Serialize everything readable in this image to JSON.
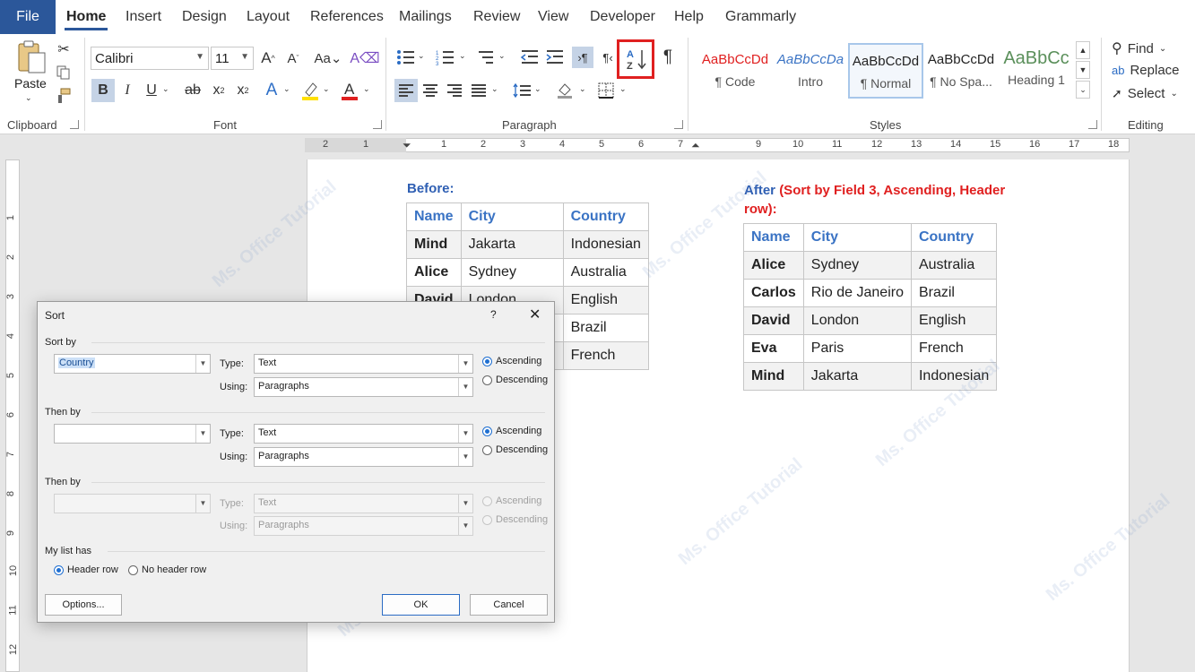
{
  "tabs": {
    "file": "File",
    "items": [
      "Home",
      "Insert",
      "Design",
      "Layout",
      "References",
      "Mailings",
      "Review",
      "View",
      "Developer",
      "Help",
      "Grammarly"
    ]
  },
  "ribbon": {
    "clipboard": {
      "label": "Clipboard",
      "paste": "Paste"
    },
    "font": {
      "label": "Font",
      "name": "Calibri",
      "size": "11"
    },
    "paragraph": {
      "label": "Paragraph"
    },
    "styles": {
      "label": "Styles",
      "items": [
        {
          "sample": "AaBbCcDd",
          "name": "¶ Code"
        },
        {
          "sample": "AaBbCcDa",
          "name": "Intro"
        },
        {
          "sample": "AaBbCcDd",
          "name": "¶ Normal"
        },
        {
          "sample": "AaBbCcDd",
          "name": "¶ No Spa..."
        },
        {
          "sample": "AaBbCc",
          "name": "Heading 1"
        }
      ]
    },
    "editing": {
      "label": "Editing",
      "find": "Find",
      "replace": "Replace",
      "select": "Select"
    }
  },
  "ruler": {
    "h_left": [
      "2",
      "1"
    ],
    "h_right": [
      "1",
      "2",
      "3",
      "4",
      "5",
      "6",
      "7",
      "9",
      "10",
      "11",
      "12",
      "13",
      "14",
      "15",
      "16",
      "17",
      "18"
    ],
    "v": [
      "1",
      "2",
      "3",
      "4",
      "5",
      "6",
      "7",
      "8",
      "9",
      "10",
      "11",
      "12"
    ]
  },
  "document": {
    "before_heading": "Before:",
    "after_heading": "After",
    "after_note_line1": "(Sort by Field 3, Ascending, Header",
    "after_note_line2": "row):",
    "before_table": {
      "headers": [
        "Name",
        "City",
        "Country"
      ],
      "rows": [
        [
          "Mind",
          "Jakarta",
          "Indonesian"
        ],
        [
          "Alice",
          "Sydney",
          "Australia"
        ],
        [
          "David",
          "London",
          "English"
        ],
        [
          "",
          "",
          "Brazil"
        ],
        [
          "",
          "",
          "French"
        ]
      ]
    },
    "after_table": {
      "headers": [
        "Name",
        "City",
        "Country"
      ],
      "rows": [
        [
          "Alice",
          "Sydney",
          "Australia"
        ],
        [
          "Carlos",
          "Rio de Janeiro",
          "Brazil"
        ],
        [
          "David",
          "London",
          "English"
        ],
        [
          "Eva",
          "Paris",
          "French"
        ],
        [
          "Mind",
          "Jakarta",
          "Indonesian"
        ]
      ]
    }
  },
  "dialog": {
    "title": "Sort",
    "help": "?",
    "close": "✕",
    "sort_by_label": "Sort by",
    "then_by_label": "Then by",
    "type_label": "Type:",
    "using_label": "Using:",
    "ascending": "Ascending",
    "descending": "Descending",
    "sort_by": {
      "field": "Country",
      "type": "Text",
      "using": "Paragraphs"
    },
    "then_by_1": {
      "field": "",
      "type": "Text",
      "using": "Paragraphs"
    },
    "then_by_2": {
      "field": "",
      "type": "Text",
      "using": "Paragraphs"
    },
    "my_list_has": "My list has",
    "header_row": "Header row",
    "no_header_row": "No header row",
    "options_button": "Options...",
    "ok_button": "OK",
    "cancel_button": "Cancel"
  },
  "watermark": "Ms. Office Tutorial",
  "colors": {
    "accent": "#2b579a",
    "highlight": "#e02020",
    "table_header": "#3a73c4"
  }
}
